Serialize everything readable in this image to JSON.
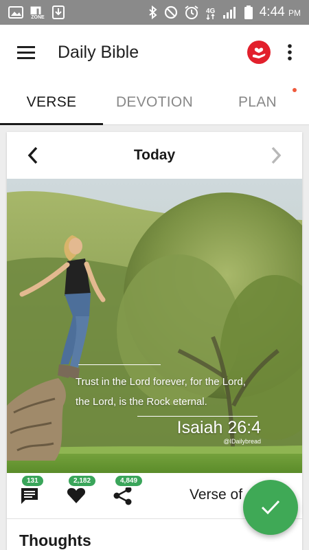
{
  "status_bar": {
    "zone_label": "ZONE",
    "time": "4:44",
    "period": "PM",
    "icons": [
      "gallery-icon",
      "mzone-icon",
      "download-icon",
      "bluetooth-icon",
      "do-not-disturb-icon",
      "alarm-icon",
      "4g-icon",
      "signal-icon",
      "battery-icon"
    ]
  },
  "app_bar": {
    "title": "Daily Bible",
    "icons": [
      "menu-icon",
      "bible-app-logo-icon",
      "more-vertical-icon"
    ]
  },
  "tabs": [
    {
      "label": "VERSE",
      "active": true
    },
    {
      "label": "DEVOTION",
      "active": false
    },
    {
      "label": "PLAN",
      "active": false,
      "has_dot": true
    }
  ],
  "card": {
    "date_label": "Today",
    "verse": {
      "text": "Trust in the Lord forever, for the Lord, the Lord, is the Rock eternal.",
      "reference": "Isaiah 26:4",
      "handle": "@IDailybread"
    },
    "actions": [
      {
        "icon": "comment-icon",
        "count": "131"
      },
      {
        "icon": "heart-icon",
        "count": "2,182"
      },
      {
        "icon": "share-icon",
        "count": "4,849"
      }
    ],
    "verse_of_label": "Verse of",
    "thoughts_heading": "Thoughts"
  },
  "colors": {
    "accent_green": "#3fa956",
    "badge_green": "#3aa55a",
    "logo_red": "#e2202c",
    "status_bar": "#8a8a8a"
  }
}
